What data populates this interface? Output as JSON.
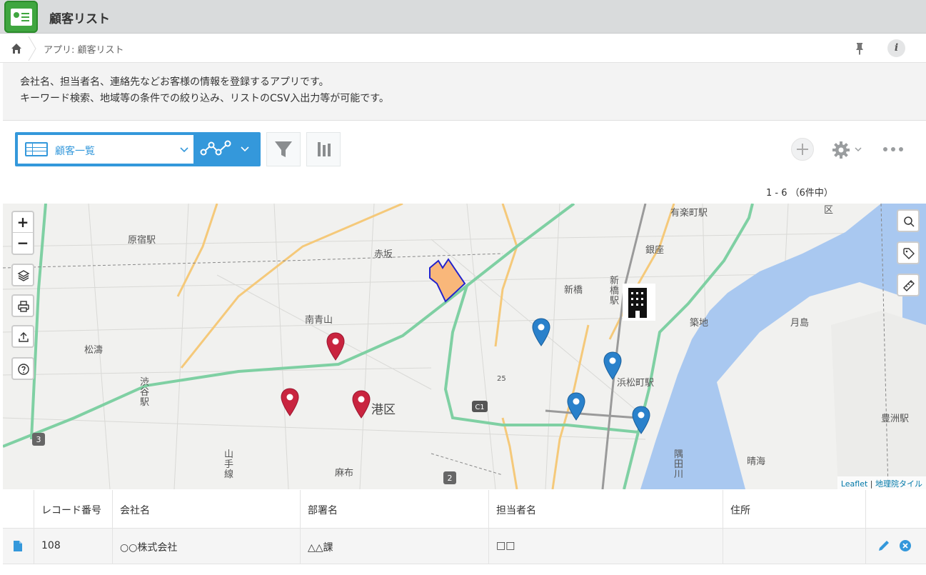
{
  "app": {
    "title": "顧客リスト"
  },
  "breadcrumb": {
    "text": "アプリ: 顧客リスト"
  },
  "description": {
    "line1": "会社名、担当者名、連絡先などお客様の情報を登録するアプリです。",
    "line2": "キーワード検索、地域等の条件での絞り込み、リストのCSV入出力等が可能です。"
  },
  "toolbar": {
    "view_label": "顧客一覧",
    "count": "1 - 6 （6件中）"
  },
  "map": {
    "labels": {
      "harajuku": "原宿駅",
      "akasaka": "赤坂",
      "yurakucho": "有楽町駅",
      "ginza": "銀座",
      "shinbashi": "新橋",
      "shinbashi_eki": "新橋駅",
      "minamiaoyama": "南青山",
      "shoto": "松濤",
      "shibuya": "渋谷駅",
      "minato": "港区",
      "hamamatsucho": "浜松町駅",
      "tsukiji": "築地",
      "tsukishima": "月島",
      "toyosu": "豊洲駅",
      "harumi": "晴海",
      "azabu": "麻布",
      "sumida": "隅田川",
      "yamanote": "山手線",
      "ku": "区",
      "c1": "C1",
      "r3": "3",
      "r2": "2",
      "m25": "25"
    },
    "attribution": {
      "leaflet": "Leaflet",
      "sep": " | ",
      "tiles": "地理院タイル"
    },
    "red_pins": 3,
    "blue_pins": 4,
    "colors": {
      "red_pin": "#c9243f",
      "blue_pin": "#2a81cb",
      "highway": "#7fd0a3",
      "major_road": "#f5c97a",
      "water": "#a9c8f0",
      "polygon_fill": "#f9b77a",
      "polygon_stroke": "#2222cc"
    }
  },
  "table": {
    "headers": [
      "レコード番号",
      "会社名",
      "部署名",
      "担当者名",
      "住所"
    ],
    "rows": [
      {
        "record_no": "108",
        "company": "○○株式会社",
        "department": "△△課",
        "person": "□□",
        "address": ""
      }
    ]
  }
}
